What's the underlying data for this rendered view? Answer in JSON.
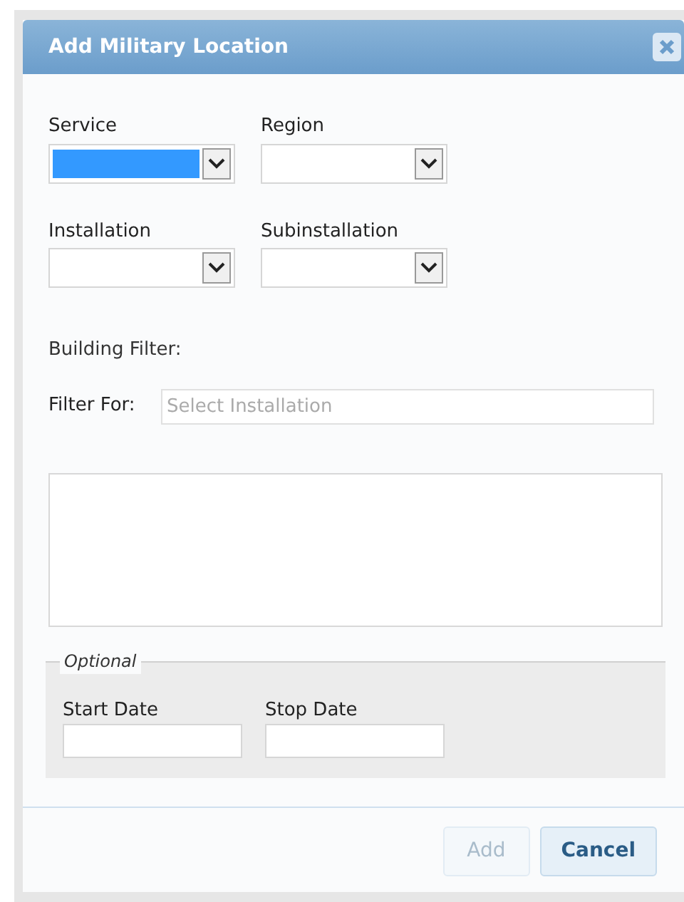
{
  "dialog": {
    "title": "Add Military Location"
  },
  "selects": [
    {
      "label": "Service",
      "focused": true
    },
    {
      "label": "Region",
      "focused": false
    },
    {
      "label": "Installation",
      "focused": false
    },
    {
      "label": "Subinstallation",
      "focused": false
    }
  ],
  "building_filter": {
    "heading": "Building Filter:",
    "label": "Filter For:",
    "placeholder": "Select Installation"
  },
  "optional": {
    "legend": "Optional",
    "fields": [
      {
        "label": "Start Date"
      },
      {
        "label": "Stop Date"
      }
    ]
  },
  "buttons": [
    {
      "label": "Add",
      "disabled": true
    },
    {
      "label": "Cancel",
      "disabled": false
    }
  ]
}
